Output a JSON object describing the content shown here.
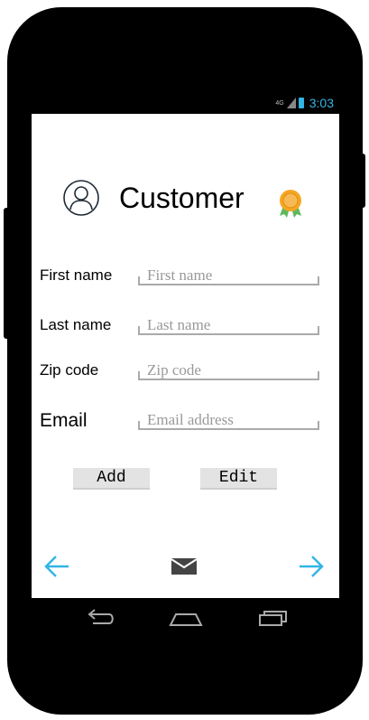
{
  "status": {
    "network": "4G",
    "time": "3:03"
  },
  "header": {
    "title": "Customer"
  },
  "form": {
    "first_name": {
      "label": "First name",
      "placeholder": "First name"
    },
    "last_name": {
      "label": "Last name",
      "placeholder": "Last name"
    },
    "zip_code": {
      "label": "Zip code",
      "placeholder": "Zip code"
    },
    "email": {
      "label": "Email",
      "placeholder": "Email address"
    }
  },
  "buttons": {
    "add": "Add",
    "edit": "Edit"
  },
  "colors": {
    "accent": "#33b5e5",
    "badge": "#f5a623"
  }
}
